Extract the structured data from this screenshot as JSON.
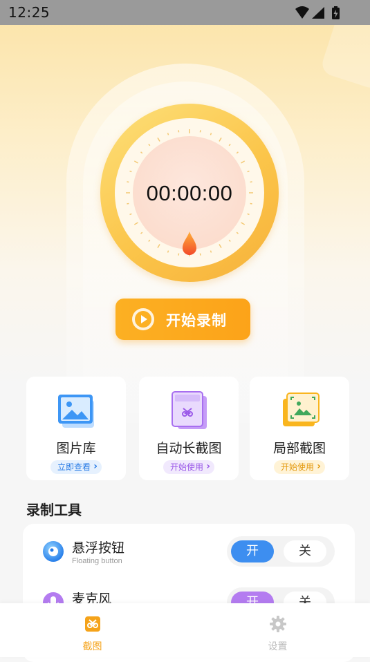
{
  "status_bar": {
    "time": "12:25"
  },
  "recorder": {
    "timer": "00:00:00",
    "start_label": "开始录制"
  },
  "cards": [
    {
      "title": "图片库",
      "action": "立即查看"
    },
    {
      "title": "自动长截图",
      "action": "开始使用"
    },
    {
      "title": "局部截图",
      "action": "开始使用"
    }
  ],
  "tools": {
    "section_title": "录制工具",
    "items": [
      {
        "name": "悬浮按钮",
        "subtitle": "Floating button",
        "on_label": "开",
        "off_label": "关",
        "state": "on"
      },
      {
        "name": "麦克风",
        "subtitle": "",
        "on_label": "开",
        "off_label": "关",
        "state": "on"
      }
    ]
  },
  "bottom_nav": {
    "items": [
      {
        "label": "截图",
        "icon": "screenshot-icon",
        "active": true
      },
      {
        "label": "设置",
        "icon": "gear-icon",
        "active": false
      }
    ]
  },
  "colors": {
    "accent_orange": "#fca319",
    "active_nav": "#f5a31a",
    "toggle_blue": "#3d8ef0",
    "toggle_purple": "#b47cf0"
  }
}
